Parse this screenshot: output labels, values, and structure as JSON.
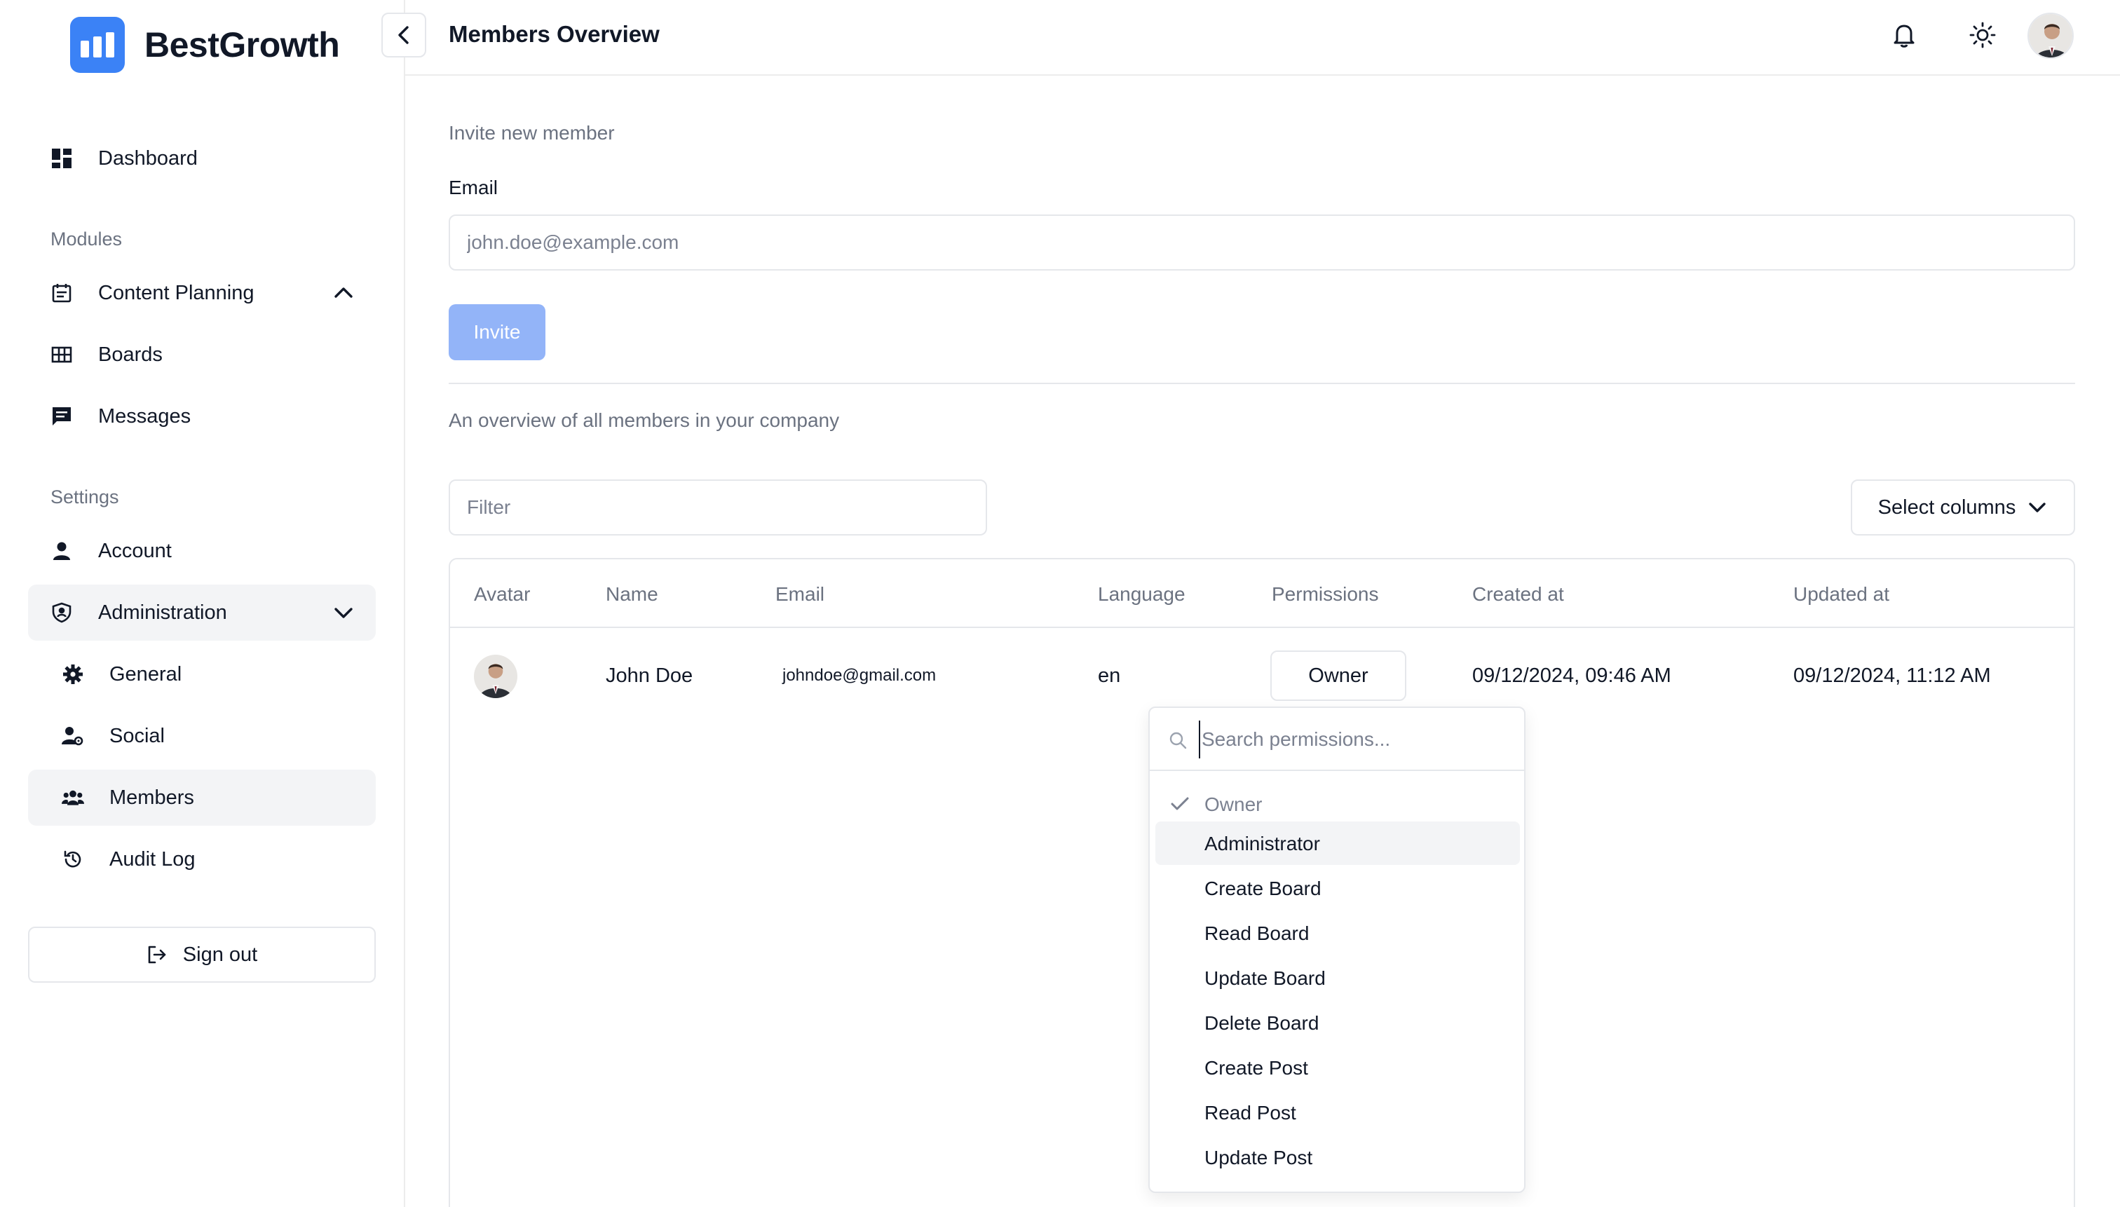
{
  "brand": {
    "name": "BestGrowth"
  },
  "sidebar": {
    "dashboard": "Dashboard",
    "modules_label": "Modules",
    "modules": [
      {
        "label": "Content Planning"
      },
      {
        "label": "Boards"
      },
      {
        "label": "Messages"
      }
    ],
    "settings_label": "Settings",
    "account": "Account",
    "administration": "Administration",
    "admin_items": [
      {
        "label": "General"
      },
      {
        "label": "Social"
      },
      {
        "label": "Members"
      },
      {
        "label": "Audit Log"
      }
    ],
    "sign_out": "Sign out"
  },
  "header": {
    "title": "Members Overview"
  },
  "invite": {
    "heading": "Invite new member",
    "email_label": "Email",
    "email_placeholder": "john.doe@example.com",
    "email_value": "",
    "button": "Invite"
  },
  "overview": {
    "description": "An overview of all members in your company",
    "filter_placeholder": "Filter",
    "select_columns": "Select columns"
  },
  "table": {
    "columns": [
      "Avatar",
      "Name",
      "Email",
      "Language",
      "Permissions",
      "Created at",
      "Updated at"
    ],
    "rows": [
      {
        "name": "John Doe",
        "email": "johndoe@gmail.com",
        "language": "en",
        "permission": "Owner",
        "created_at": "09/12/2024, 09:46 AM",
        "updated_at": "09/12/2024, 11:12 AM"
      }
    ]
  },
  "permissions_dropdown": {
    "search_placeholder": "Search permissions...",
    "options": [
      {
        "label": "Owner",
        "selected": true
      },
      {
        "label": "Administrator",
        "highlighted": true
      },
      {
        "label": "Create Board"
      },
      {
        "label": "Read Board"
      },
      {
        "label": "Update Board"
      },
      {
        "label": "Delete Board"
      },
      {
        "label": "Create Post"
      },
      {
        "label": "Read Post"
      },
      {
        "label": "Update Post"
      }
    ]
  },
  "colors": {
    "brand": "#3b82f6",
    "invite_button_disabled": "#93b4f8",
    "active_bg": "#f3f4f6",
    "border": "#e5e7eb"
  }
}
